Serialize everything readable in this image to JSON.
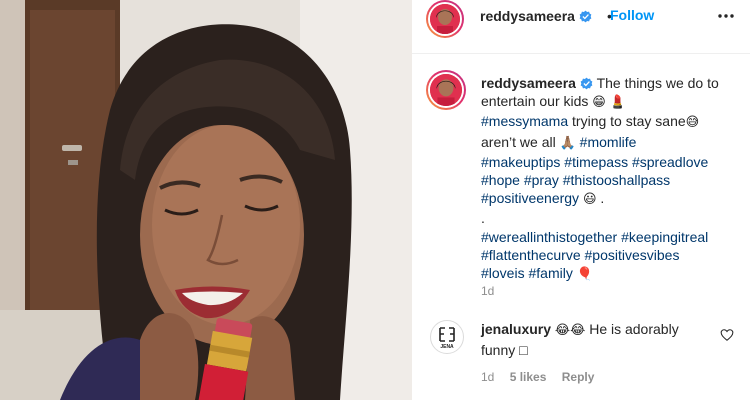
{
  "post": {
    "username": "reddysameera",
    "separator": "•",
    "follow_label": "Follow",
    "more_icon": "more-options-icon"
  },
  "caption": {
    "username": "reddysameera",
    "line1": "The things we do to entertain our kids",
    "emoji1": "😁",
    "emoji2": "💄",
    "tag_messymama": "#messymama",
    "text_trying": " trying to stay sane",
    "emoji3": "😅",
    "text_arent": "aren’t we all ",
    "emoji4": "🙏🏽",
    "tag_momlife": "#momlife",
    "tag_makeuptips": "#makeuptips",
    "tag_timepass": "#timepass",
    "tag_spreadlove": "#spreadlove",
    "tag_hope": "#hope",
    "tag_pray": "#pray",
    "tag_thistooshallpass": "#thistooshallpass",
    "tag_positiveenergy": "#positiveenergy",
    "emoji5": "😃",
    "text_period": " .",
    "text_dot": ".",
    "tag_wereallinthistogether": "#wereallinthistogether",
    "tag_keepingitreal": "#keepingitreal",
    "tag_flattenthecurve": "#flattenthecurve",
    "tag_positivesvibes": "#positivesvibes",
    "tag_loveis": "#loveis",
    "tag_family": "#family",
    "emoji6": "🎈",
    "time": "1d"
  },
  "comment": {
    "avatar_text": "JENA",
    "username": "jenaluxury",
    "emoji": "😂😂",
    "text": " He is adorably funny ",
    "trailing_glyph": "□",
    "time": "1d",
    "likes": "5 likes",
    "reply": "Reply"
  },
  "colors": {
    "link_blue": "#0095f6",
    "hashtag": "#00376b",
    "muted": "#8e8e8e",
    "text": "#262626",
    "verified_blue": "#3897f0"
  }
}
